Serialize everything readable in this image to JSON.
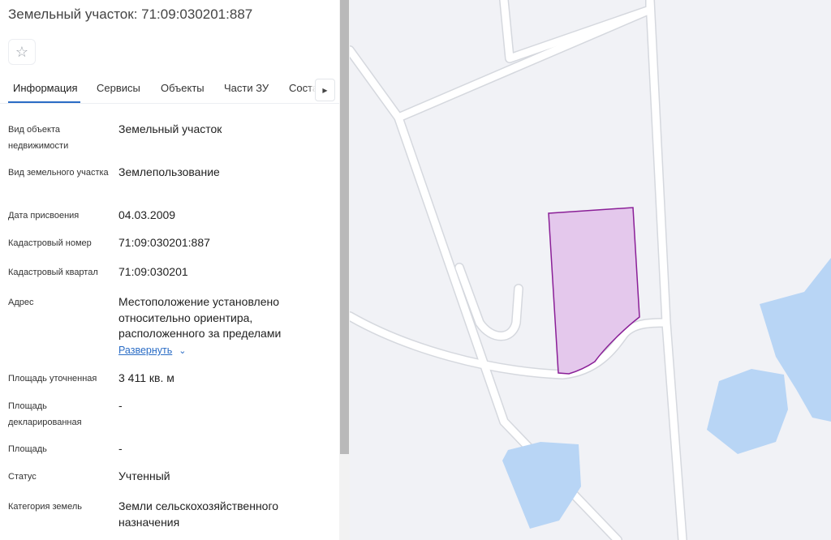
{
  "header": {
    "title": "Земельный участок: 71:09:030201:887",
    "favorite_icon": "star-outline-icon"
  },
  "tabs": [
    {
      "label": "Информация",
      "active": true
    },
    {
      "label": "Сервисы"
    },
    {
      "label": "Объекты"
    },
    {
      "label": "Части ЗУ"
    },
    {
      "label": "Состав"
    }
  ],
  "tab_scroll_icon": "chevron-right-icon",
  "info": {
    "object_type": {
      "label": "Вид объекта недвижимости",
      "value": "Земельный участок"
    },
    "parcel_type": {
      "label": "Вид земельного участка",
      "value": "Землепользование"
    },
    "assigned_date": {
      "label": "Дата присвоения",
      "value": "04.03.2009"
    },
    "cadastral_number": {
      "label": "Кадастровый номер",
      "value": "71:09:030201:887"
    },
    "cadastral_block": {
      "label": "Кадастровый квартал",
      "value": "71:09:030201"
    },
    "address": {
      "label": "Адрес",
      "value": "Местоположение установлено относительно ориентира, расположенного за пределами",
      "expand_label": "Развернуть"
    },
    "area_refined": {
      "label": "Площадь уточненная",
      "value": "3 411 кв. м"
    },
    "area_declared": {
      "label": "Площадь декларированная",
      "value": "-"
    },
    "area": {
      "label": "Площадь",
      "value": "-"
    },
    "status": {
      "label": "Статус",
      "value": "Учтенный"
    },
    "land_category": {
      "label": "Категория земель",
      "value": "Земли сельскохозяйственного назначения"
    }
  },
  "colors": {
    "accent": "#2a6cc5",
    "parcel_fill": "#e4c8ec",
    "parcel_stroke": "#8a1f97",
    "water": "#b8d5f5",
    "road": "#ffffff",
    "road_edge": "#cfd3da",
    "map_bg": "#f1f2f6"
  }
}
